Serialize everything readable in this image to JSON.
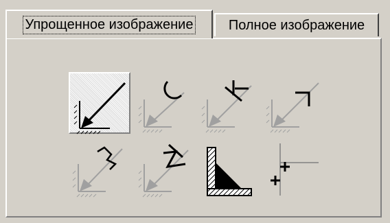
{
  "tabs": [
    {
      "label": "Упрощенное изображение",
      "active": true
    },
    {
      "label": "Полное изображение",
      "active": false
    }
  ],
  "symbols": [
    {
      "name": "weld-arrow-plain-symbol",
      "selected": true
    },
    {
      "name": "weld-arrow-arc-symbol",
      "selected": false
    },
    {
      "name": "weld-arrow-star-symbol",
      "selected": false
    },
    {
      "name": "weld-arrow-corner-symbol",
      "selected": false
    },
    {
      "name": "weld-arrow-bracket-symbol",
      "selected": false
    },
    {
      "name": "weld-arrow-zigzag-symbol",
      "selected": false
    },
    {
      "name": "weld-fillet-triangle-symbol",
      "selected": false
    },
    {
      "name": "weld-plus-offset-symbol",
      "selected": false
    }
  ],
  "colors": {
    "face": "#d4d0c8",
    "highlight": "#ffffff",
    "shadow": "#808080",
    "disabled": "#a0a0a0"
  }
}
